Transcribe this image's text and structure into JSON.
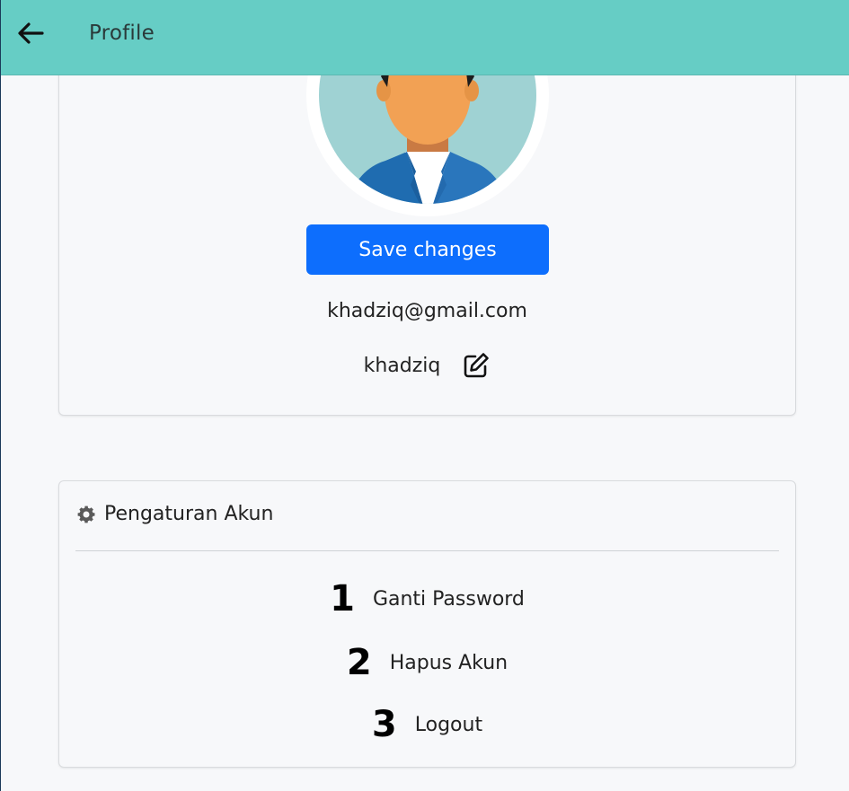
{
  "header": {
    "title": "Profile",
    "back_icon": "arrow-left-icon",
    "background": "#66cdc5"
  },
  "profile": {
    "save_label": "Save changes",
    "email": "khadziq@gmail.com",
    "username": "khadziq",
    "edit_icon": "edit-icon",
    "accent": "#0d6efd"
  },
  "settings": {
    "title": "Pengaturan Akun",
    "icon": "gear-icon",
    "items": [
      {
        "number": "1",
        "label": "Ganti Password"
      },
      {
        "number": "2",
        "label": "Hapus Akun"
      },
      {
        "number": "3",
        "label": "Logout"
      }
    ]
  }
}
